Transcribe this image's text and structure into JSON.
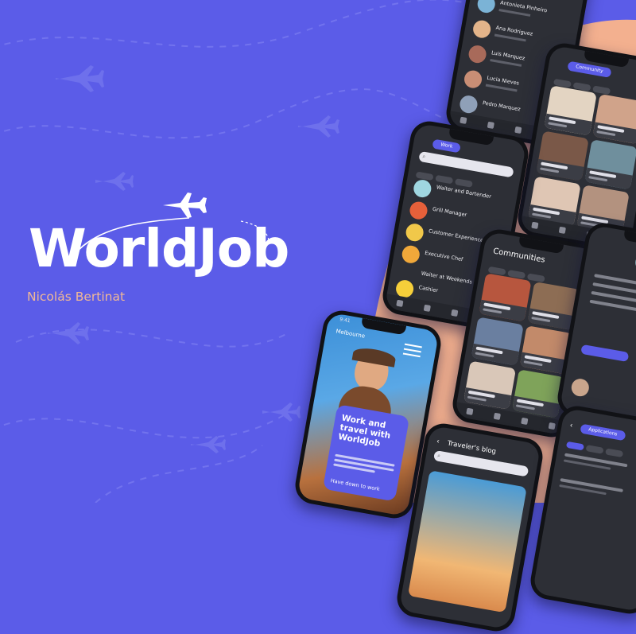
{
  "brand": {
    "title": "WorldJob",
    "author": "Nicolás Bertinat"
  },
  "colors": {
    "background": "#5b5ce8",
    "accent_blob": "#f3b08f",
    "author_text": "#f0b896",
    "phone_screen": "#2d2f36"
  },
  "icons": [
    "airplane-icon",
    "dashed-flight-path"
  ],
  "phones": {
    "messages": {
      "contacts": [
        {
          "name": "Antonieta Pinheiro"
        },
        {
          "name": "Ana Rodriguez"
        },
        {
          "name": "Luis Marquez"
        },
        {
          "name": "Lucia Nieves"
        },
        {
          "name": "Pedro Marquez"
        }
      ]
    },
    "work": {
      "tab": "Work",
      "jobs": [
        {
          "title": "Waiter and Bartender"
        },
        {
          "title": "Grill Manager"
        },
        {
          "title": "Customer Experience"
        },
        {
          "title": "Executive Chef"
        },
        {
          "title": "Waiter at Weekends"
        },
        {
          "title": "Cashier"
        }
      ]
    },
    "community": {
      "tab": "Community"
    },
    "communities": {
      "title": "Communities"
    },
    "welcome": {
      "clock": "9:41",
      "city": "Melbourne",
      "headline": "Work and travel with WorldJob",
      "link": "Have down to work"
    },
    "blog": {
      "title": "Traveler's blog"
    },
    "applications": {
      "tab": "Applications"
    }
  }
}
